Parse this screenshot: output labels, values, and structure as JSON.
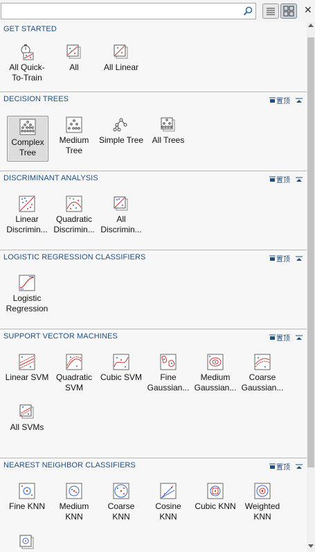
{
  "search": {
    "placeholder": "",
    "value": ""
  },
  "sections": [
    {
      "title": "GET STARTED",
      "items": [
        "All Quick-\nTo-Train",
        "All",
        "All Linear"
      ]
    },
    {
      "title": "DECISION TREES",
      "tool": "置顶",
      "items": [
        "Complex\nTree",
        "Medium\nTree",
        "Simple Tree",
        "All Trees"
      ],
      "selected": 0
    },
    {
      "title": "DISCRIMINANT ANALYSIS",
      "tool": "置顶",
      "items": [
        "Linear\nDiscrimin...",
        "Quadratic\nDiscrimin...",
        "All\nDiscrimin..."
      ]
    },
    {
      "title": "LOGISTIC REGRESSION CLASSIFIERS",
      "tool": "置顶",
      "items": [
        "Logistic\nRegression"
      ]
    },
    {
      "title": "SUPPORT VECTOR MACHINES",
      "tool": "置顶",
      "items": [
        "Linear SVM",
        "Quadratic\nSVM",
        "Cubic SVM",
        "Fine\nGaussian...",
        "Medium\nGaussian...",
        "Coarse\nGaussian...",
        "All SVMs"
      ]
    },
    {
      "title": "NEAREST NEIGHBOR CLASSIFIERS",
      "tool": "置顶",
      "items": [
        "Fine KNN",
        "Medium\nKNN",
        "Coarse\nKNN",
        "Cosine\nKNN",
        "Cubic KNN",
        "Weighted\nKNN"
      ]
    }
  ],
  "labels": {
    "s0i0a": "All Quick-",
    "s0i0b": "To-Train",
    "s0i1a": "All",
    "s0i2a": "All Linear",
    "s1i0a": "Complex",
    "s1i0b": "Tree",
    "s1i1a": "Medium",
    "s1i1b": "Tree",
    "s1i2a": "Simple Tree",
    "s1i3a": "All Trees",
    "s2i0a": "Linear",
    "s2i0b": "Discrimin...",
    "s2i1a": "Quadratic",
    "s2i1b": "Discrimin...",
    "s2i2a": "All",
    "s2i2b": "Discrimin...",
    "s3i0a": "Logistic",
    "s3i0b": "Regression",
    "s4i0a": "Linear SVM",
    "s4i1a": "Quadratic",
    "s4i1b": "SVM",
    "s4i2a": "Cubic SVM",
    "s4i3a": "Fine",
    "s4i3b": "Gaussian...",
    "s4i4a": "Medium",
    "s4i4b": "Gaussian...",
    "s4i5a": "Coarse",
    "s4i5b": "Gaussian...",
    "s4i6a": "All SVMs",
    "s5i0a": "Fine KNN",
    "s5i1a": "Medium",
    "s5i1b": "KNN",
    "s5i2a": "Coarse",
    "s5i2b": "KNN",
    "s5i3a": "Cosine",
    "s5i3b": "KNN",
    "s5i4a": "Cubic KNN",
    "s5i5a": "Weighted",
    "s5i5b": "KNN"
  },
  "titles": {
    "s0": "GET STARTED",
    "s1": "DECISION TREES",
    "s2": "DISCRIMINANT ANALYSIS",
    "s3": "LOGISTIC REGRESSION CLASSIFIERS",
    "s4": "SUPPORT VECTOR MACHINES",
    "s5": "NEAREST NEIGHBOR CLASSIFIERS"
  },
  "tool_label": "置顶",
  "icons": {
    "search": "magnifier-icon",
    "list_view": "list-view-icon",
    "grid_view": "grid-view-icon",
    "close": "close-icon",
    "pin": "pin-top-icon",
    "collapse": "collapse-up-icon"
  },
  "colors": {
    "section_title": "#1f4f82",
    "divider": "#b7b7b7",
    "selected_bg": "#dcdcdc"
  }
}
